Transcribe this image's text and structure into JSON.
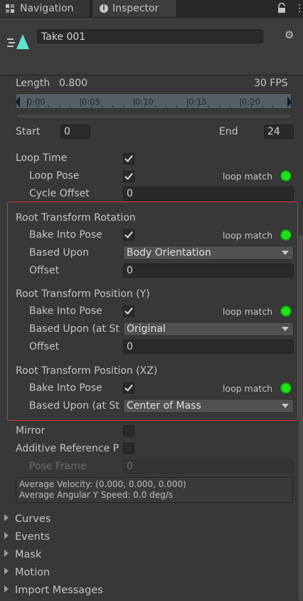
{
  "tabs": [
    {
      "label": "Navigation",
      "icon": "grid-icon"
    },
    {
      "label": "Inspector",
      "icon": "info-icon"
    }
  ],
  "header": {
    "clip_name": "Take 001"
  },
  "timeline": {
    "length_label": "Length",
    "length_value": "0.800",
    "fps": "30 FPS",
    "ticks": [
      "0:00",
      "0:05",
      "0:10",
      "0:15",
      "0:20"
    ]
  },
  "range": {
    "start_label": "Start",
    "start_value": "0",
    "end_label": "End",
    "end_value": "24"
  },
  "loop": {
    "loop_time_label": "Loop Time",
    "loop_pose_label": "Loop Pose",
    "loop_match_label": "loop match",
    "cycle_offset_label": "Cycle Offset",
    "cycle_offset_value": "0"
  },
  "root_rotation": {
    "title": "Root Transform Rotation",
    "bake_label": "Bake Into Pose",
    "loop_match_label": "loop match",
    "based_upon_label": "Based Upon",
    "based_upon_value": "Body Orientation",
    "offset_label": "Offset",
    "offset_value": "0"
  },
  "root_position_y": {
    "title": "Root Transform Position (Y)",
    "bake_label": "Bake Into Pose",
    "loop_match_label": "loop match",
    "based_upon_label": "Based Upon (at St",
    "based_upon_value": "Original",
    "offset_label": "Offset",
    "offset_value": "0"
  },
  "root_position_xz": {
    "title": "Root Transform Position (XZ)",
    "bake_label": "Bake Into Pose",
    "loop_match_label": "loop match",
    "based_upon_label": "Based Upon (at St",
    "based_upon_value": "Center of Mass"
  },
  "misc": {
    "mirror_label": "Mirror",
    "additive_label": "Additive Reference P",
    "pose_frame_label": "Pose Frame",
    "pose_frame_value": "0",
    "avg_velocity": "Average Velocity: (0.000, 0.000, 0.000)",
    "avg_angular": "Average Angular Y Speed: 0.0 deg/s"
  },
  "foldouts": [
    "Curves",
    "Events",
    "Mask",
    "Motion",
    "Import Messages"
  ],
  "colors": {
    "highlight_border": "#e0302b",
    "loop_match_ok": "#23e01e",
    "clip_icon": "#5fe3d0"
  }
}
